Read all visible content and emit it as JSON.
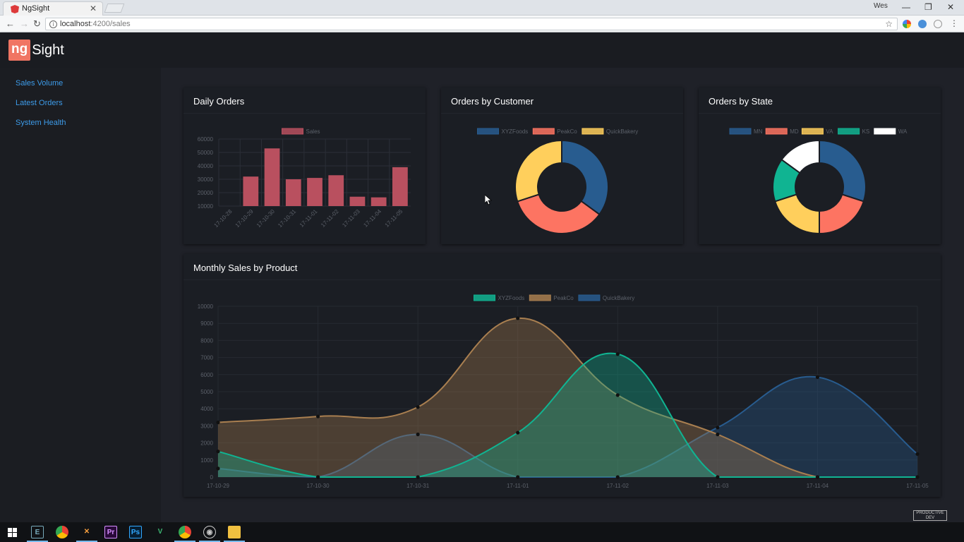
{
  "browser": {
    "tab_title": "NgSight",
    "url_host": "localhost",
    "url_path": ":4200/sales",
    "user_badge": "Wes"
  },
  "app": {
    "logo_ng": "ng",
    "logo_sight": "Sight"
  },
  "sidebar": {
    "items": [
      {
        "label": "Sales Volume"
      },
      {
        "label": "Latest Orders"
      },
      {
        "label": "System Health"
      }
    ]
  },
  "colors": {
    "accent": "#f07563",
    "blue": "#285c8f",
    "coral": "#fd7462",
    "yellow": "#ffcf5c",
    "teal": "#10b492",
    "white": "#ffffff",
    "bar": "#b9505f",
    "link": "#3d9be9"
  },
  "cards": {
    "daily_orders": {
      "title": "Daily Orders"
    },
    "orders_by_customer": {
      "title": "Orders by Customer"
    },
    "orders_by_state": {
      "title": "Orders by State"
    },
    "monthly_sales": {
      "title": "Monthly Sales by Product"
    }
  },
  "chart_data": [
    {
      "type": "bar",
      "title": "Daily Orders",
      "legend": [
        "Sales"
      ],
      "categories": [
        "17-10-28",
        "17-10-29",
        "17-10-30",
        "17-10-31",
        "17-11-01",
        "17-11-02",
        "17-11-03",
        "17-11-04",
        "17-11-05"
      ],
      "series": [
        {
          "name": "Sales",
          "values": [
            10000,
            32000,
            53000,
            30000,
            31000,
            33000,
            17000,
            16500,
            39000
          ]
        }
      ],
      "y_ticks": [
        10000,
        20000,
        30000,
        40000,
        50000,
        60000
      ],
      "ylim": [
        10000,
        60000
      ],
      "legend_position": "top"
    },
    {
      "type": "pie",
      "title": "Orders by Customer",
      "labels": [
        "XYZFoods",
        "PeakCo",
        "QuickBakery"
      ],
      "values": [
        35,
        35,
        30
      ],
      "colors": [
        "#285c8f",
        "#fd7462",
        "#ffcf5c"
      ],
      "legend_position": "top"
    },
    {
      "type": "pie",
      "title": "Orders by State",
      "labels": [
        "MN",
        "MD",
        "VA",
        "KS",
        "WA"
      ],
      "values": [
        30,
        20,
        20,
        15,
        15
      ],
      "colors": [
        "#285c8f",
        "#fd7462",
        "#ffcf5c",
        "#10b492",
        "#ffffff"
      ],
      "legend_position": "top"
    },
    {
      "type": "area",
      "title": "Monthly Sales by Product",
      "x": [
        "17-10-29",
        "17-10-30",
        "17-10-31",
        "17-11-01",
        "17-11-02",
        "17-11-03",
        "17-11-04",
        "17-11-05"
      ],
      "series": [
        {
          "name": "XYZFoods",
          "values": [
            1500,
            0,
            0,
            2600,
            7200,
            0,
            0,
            0
          ],
          "color": "#10b492"
        },
        {
          "name": "PeakCo",
          "values": [
            3200,
            3550,
            4100,
            9300,
            4800,
            2500,
            0,
            0
          ],
          "color": "#a97f50"
        },
        {
          "name": "QuickBakery",
          "values": [
            500,
            0,
            2500,
            0,
            0,
            2900,
            5850,
            1350
          ],
          "color": "#285c8f"
        }
      ],
      "y_ticks": [
        0,
        1000,
        2000,
        3000,
        4000,
        5000,
        6000,
        7000,
        8000,
        9000,
        10000
      ],
      "ylim": [
        0,
        10000
      ],
      "legend_position": "top"
    }
  ],
  "watermark": {
    "line1": "PRODUCTIVE",
    "line2": "DEV"
  }
}
